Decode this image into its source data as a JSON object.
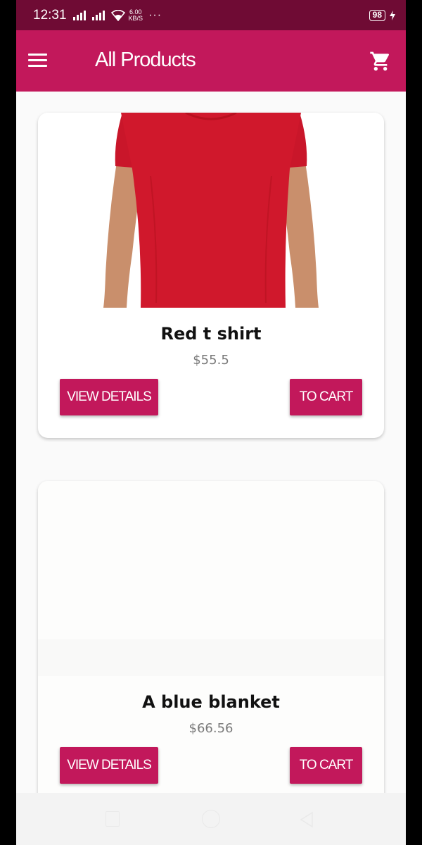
{
  "status_bar": {
    "time": "12:31",
    "network_speed_value": "6.00",
    "network_speed_unit": "KB/S",
    "more": "···",
    "battery": "98"
  },
  "app_bar": {
    "title": "All Products",
    "menu_icon": "hamburger-menu-icon",
    "cart_icon": "shopping-cart-icon"
  },
  "products": [
    {
      "title": "Red t shirt",
      "price": "$55.5",
      "image": "red-t-shirt-photo",
      "view_details_label": "VIEW DETAILS",
      "to_cart_label": "TO CART"
    },
    {
      "title": "A blue blanket",
      "price": "$66.56",
      "image": "blank-product-photo",
      "view_details_label": "VIEW DETAILS",
      "to_cart_label": "TO CART"
    }
  ],
  "nav_bar": {
    "recent_icon": "recent-apps-icon",
    "home_icon": "home-icon",
    "back_icon": "back-icon"
  },
  "colors": {
    "primary": "#c2185b",
    "status_bar": "#6f0b34",
    "background": "#fafafa",
    "product_red": "#d0182c"
  }
}
